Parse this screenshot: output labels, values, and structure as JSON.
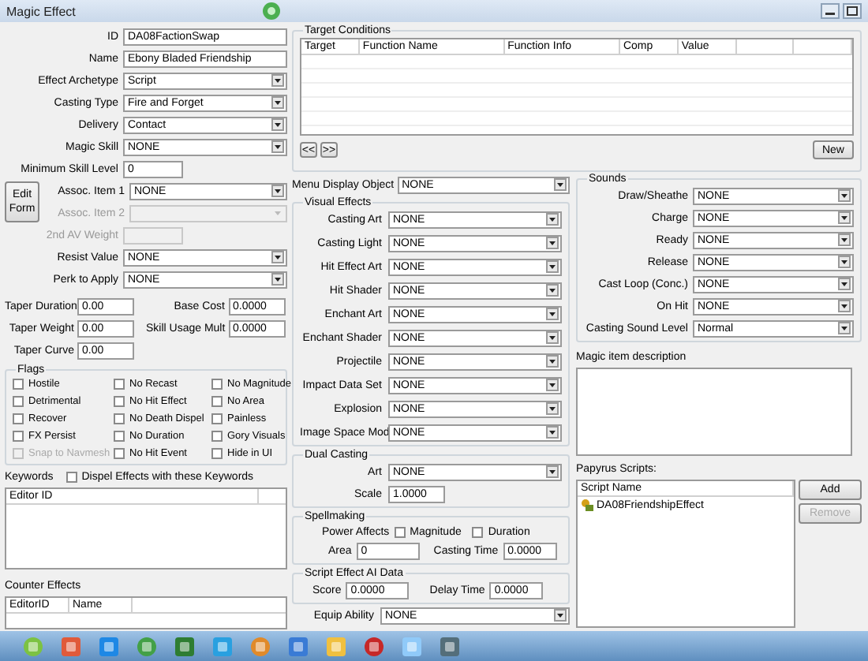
{
  "window": {
    "title": "Magic Effect"
  },
  "main_fields": [
    {
      "kind": "text",
      "label": "ID",
      "value": "DA08FactionSwap"
    },
    {
      "kind": "text",
      "label": "Name",
      "value": "Ebony Bladed Friendship"
    },
    {
      "kind": "select",
      "label": "Effect Archetype",
      "value": "Script"
    },
    {
      "kind": "select",
      "label": "Casting Type",
      "value": "Fire and Forget"
    },
    {
      "kind": "select",
      "label": "Delivery",
      "value": "Contact"
    },
    {
      "kind": "select",
      "label": "Magic Skill",
      "value": "NONE"
    },
    {
      "kind": "short",
      "label": "Minimum Skill Level",
      "value": "0"
    }
  ],
  "edit_form_button": "Edit Form",
  "assoc_fields": [
    {
      "label": "Assoc. Item 1",
      "value": "NONE",
      "disabled": false
    },
    {
      "label": "Assoc. Item 2",
      "disabled": true
    }
  ],
  "more_fields": [
    {
      "kind": "short",
      "label": "2nd AV Weight",
      "disabled": true
    },
    {
      "kind": "select",
      "label": "Resist Value",
      "value": "NONE",
      "disabled": false
    },
    {
      "kind": "select",
      "label": "Perk to Apply",
      "value": "NONE",
      "disabled": false
    }
  ],
  "taper": [
    {
      "label": "Taper Duration",
      "value": "0.00"
    },
    {
      "label": "Base Cost",
      "value": "0.0000"
    },
    {
      "label": "Taper Weight",
      "value": "0.00"
    },
    {
      "label": "Skill Usage Mult",
      "value": "0.0000"
    },
    {
      "label": "Taper Curve",
      "value": "0.00"
    }
  ],
  "flags": {
    "title": "Flags",
    "items": [
      {
        "label": "Hostile",
        "checked": false,
        "disabled": false
      },
      {
        "label": "No Recast",
        "checked": false,
        "disabled": false
      },
      {
        "label": "No Magnitude",
        "checked": false,
        "disabled": false
      },
      {
        "label": "Detrimental",
        "checked": false,
        "disabled": false
      },
      {
        "label": "No Hit Effect",
        "checked": false,
        "disabled": false
      },
      {
        "label": "No Area",
        "checked": false,
        "disabled": false
      },
      {
        "label": "Recover",
        "checked": false,
        "disabled": false
      },
      {
        "label": "No Death Dispel",
        "checked": false,
        "disabled": false
      },
      {
        "label": "Painless",
        "checked": false,
        "disabled": false
      },
      {
        "label": "FX Persist",
        "checked": false,
        "disabled": false
      },
      {
        "label": "No Duration",
        "checked": false,
        "disabled": false
      },
      {
        "label": "Gory Visuals",
        "checked": false,
        "disabled": false
      },
      {
        "label": "Snap to Navmesh",
        "checked": false,
        "disabled": true
      },
      {
        "label": "No Hit Event",
        "checked": false,
        "disabled": false
      },
      {
        "label": "Hide in UI",
        "checked": false,
        "disabled": false
      }
    ]
  },
  "keywords": {
    "title": "Keywords",
    "dispel": {
      "label": "Dispel Effects with these Keywords",
      "checked": false
    },
    "columns": [
      "Editor ID"
    ]
  },
  "counter_effects": {
    "title": "Counter Effects",
    "columns": [
      "EditorID",
      "Name"
    ]
  },
  "target_conditions": {
    "title": "Target Conditions",
    "columns": [
      "Target",
      "Function Name",
      "Function Info",
      "Comp",
      "Value"
    ],
    "prev_button": "<<",
    "next_button": ">>",
    "new_button": "New"
  },
  "menu_display_object": {
    "label": "Menu Display Object",
    "value": "NONE"
  },
  "visual_effects": {
    "title": "Visual Effects",
    "fields": [
      {
        "label": "Casting Art",
        "value": "NONE"
      },
      {
        "label": "Casting Light",
        "value": "NONE"
      },
      {
        "label": "Hit Effect Art",
        "value": "NONE"
      },
      {
        "label": "Hit Shader",
        "value": "NONE"
      },
      {
        "label": "Enchant Art",
        "value": "NONE"
      },
      {
        "label": "Enchant Shader",
        "value": "NONE"
      },
      {
        "label": "Projectile",
        "value": "NONE"
      },
      {
        "label": "Impact Data Set",
        "value": "NONE"
      },
      {
        "label": "Explosion",
        "value": "NONE"
      },
      {
        "label": "Image Space Mod",
        "value": "NONE"
      }
    ]
  },
  "dual_casting": {
    "title": "Dual Casting",
    "art": {
      "label": "Art",
      "value": "NONE"
    },
    "scale": {
      "label": "Scale",
      "value": "1.0000"
    }
  },
  "spellmaking": {
    "title": "Spellmaking",
    "power_affects": "Power Affects",
    "checks": [
      {
        "label": "Magnitude",
        "checked": false
      },
      {
        "label": "Duration",
        "checked": false
      }
    ],
    "area": {
      "label": "Area",
      "value": "0"
    },
    "casting_time": {
      "label": "Casting Time",
      "value": "0.0000"
    }
  },
  "script_ai": {
    "title": "Script Effect AI Data",
    "score": {
      "label": "Score",
      "value": "0.0000"
    },
    "delay_time": {
      "label": "Delay Time",
      "value": "0.0000"
    }
  },
  "equip_ability": {
    "label": "Equip Ability",
    "value": "NONE"
  },
  "sounds": {
    "title": "Sounds",
    "fields": [
      {
        "label": "Draw/Sheathe",
        "value": "NONE"
      },
      {
        "label": "Charge",
        "value": "NONE"
      },
      {
        "label": "Ready",
        "value": "NONE"
      },
      {
        "label": "Release",
        "value": "NONE"
      },
      {
        "label": "Cast Loop (Conc.)",
        "value": "NONE"
      },
      {
        "label": "On Hit",
        "value": "NONE"
      },
      {
        "label": "Casting Sound Level",
        "value": "Normal"
      }
    ]
  },
  "description": {
    "label": "Magic item description"
  },
  "papyrus": {
    "title": "Papyrus Scripts:",
    "columns": [
      "Script Name"
    ],
    "scripts": [
      {
        "name": "DA08FriendshipEffect"
      }
    ],
    "add_button": "Add",
    "remove_button": {
      "label": "Remove",
      "disabled": true
    }
  }
}
